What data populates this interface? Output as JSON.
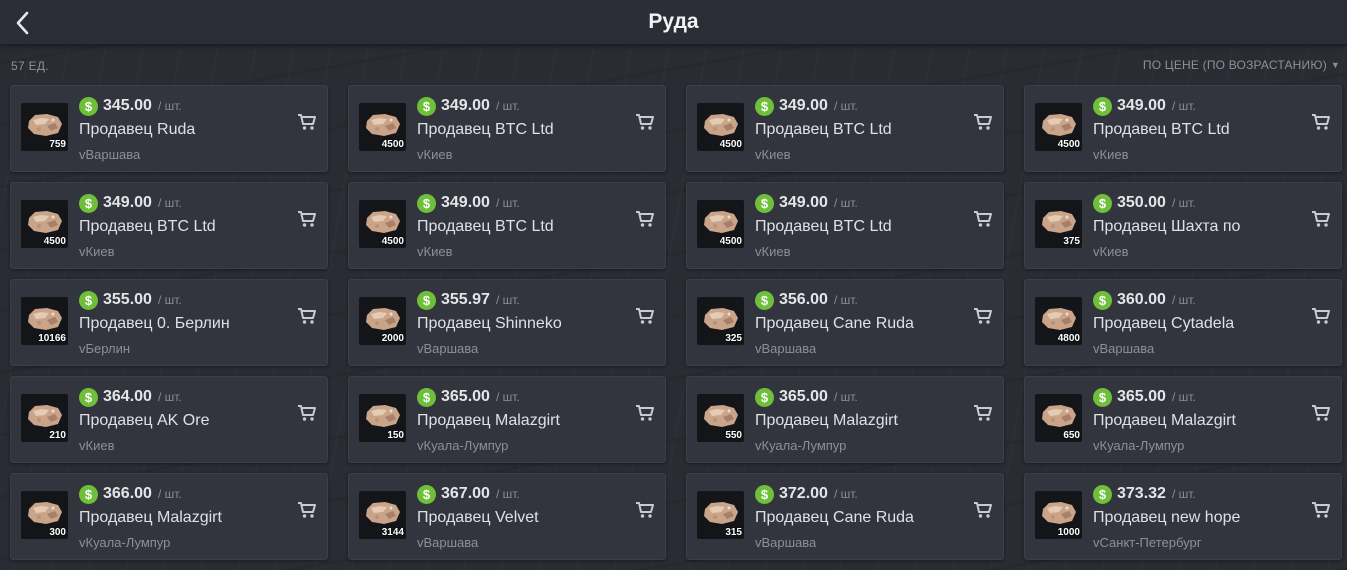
{
  "header": {
    "title": "Руда",
    "back_icon": "chevron-left-icon"
  },
  "summary": {
    "count": "57 ЕД.",
    "sort_label": "ПО ЦЕНЕ (ПО ВОЗРАСТАНИЮ)"
  },
  "unit_label": "/ шт.",
  "colors": {
    "dollar_badge": "#6fbf3b",
    "card_bg": "#32353e",
    "page_bg": "#2a2c33"
  },
  "listings": [
    {
      "price": "345.00",
      "seller": "Продавец Ruda",
      "city": "vВаршава",
      "qty": "759"
    },
    {
      "price": "349.00",
      "seller": "Продавец BTC Ltd",
      "city": "vКиев",
      "qty": "4500"
    },
    {
      "price": "349.00",
      "seller": "Продавец BTC Ltd",
      "city": "vКиев",
      "qty": "4500"
    },
    {
      "price": "349.00",
      "seller": "Продавец BTC Ltd",
      "city": "vКиев",
      "qty": "4500"
    },
    {
      "price": "349.00",
      "seller": "Продавец BTC Ltd",
      "city": "vКиев",
      "qty": "4500"
    },
    {
      "price": "349.00",
      "seller": "Продавец BTC Ltd",
      "city": "vКиев",
      "qty": "4500"
    },
    {
      "price": "349.00",
      "seller": "Продавец BTC Ltd",
      "city": "vКиев",
      "qty": "4500"
    },
    {
      "price": "350.00",
      "seller": "Продавец Шахта по",
      "city": "vКиев",
      "qty": "375"
    },
    {
      "price": "355.00",
      "seller": "Продавец 0. Берлин",
      "city": "vБерлин",
      "qty": "10166"
    },
    {
      "price": "355.97",
      "seller": "Продавец Shinneko",
      "city": "vВаршава",
      "qty": "2000"
    },
    {
      "price": "356.00",
      "seller": "Продавец Cane Ruda",
      "city": "vВаршава",
      "qty": "325"
    },
    {
      "price": "360.00",
      "seller": "Продавец Cytadela",
      "city": "vВаршава",
      "qty": "4800"
    },
    {
      "price": "364.00",
      "seller": "Продавец AK Ore",
      "city": "vКиев",
      "qty": "210"
    },
    {
      "price": "365.00",
      "seller": "Продавец Malazgirt",
      "city": "vКуала-Лумпур",
      "qty": "150"
    },
    {
      "price": "365.00",
      "seller": "Продавец Malazgirt",
      "city": "vКуала-Лумпур",
      "qty": "550"
    },
    {
      "price": "365.00",
      "seller": "Продавец Malazgirt",
      "city": "vКуала-Лумпур",
      "qty": "650"
    },
    {
      "price": "366.00",
      "seller": "Продавец Malazgirt",
      "city": "vКуала-Лумпур",
      "qty": "300"
    },
    {
      "price": "367.00",
      "seller": "Продавец Velvet",
      "city": "vВаршава",
      "qty": "3144"
    },
    {
      "price": "372.00",
      "seller": "Продавец Cane Ruda",
      "city": "vВаршава",
      "qty": "315"
    },
    {
      "price": "373.32",
      "seller": "Продавец new hope",
      "city": "vСанкт-Петербург",
      "qty": "1000"
    }
  ]
}
